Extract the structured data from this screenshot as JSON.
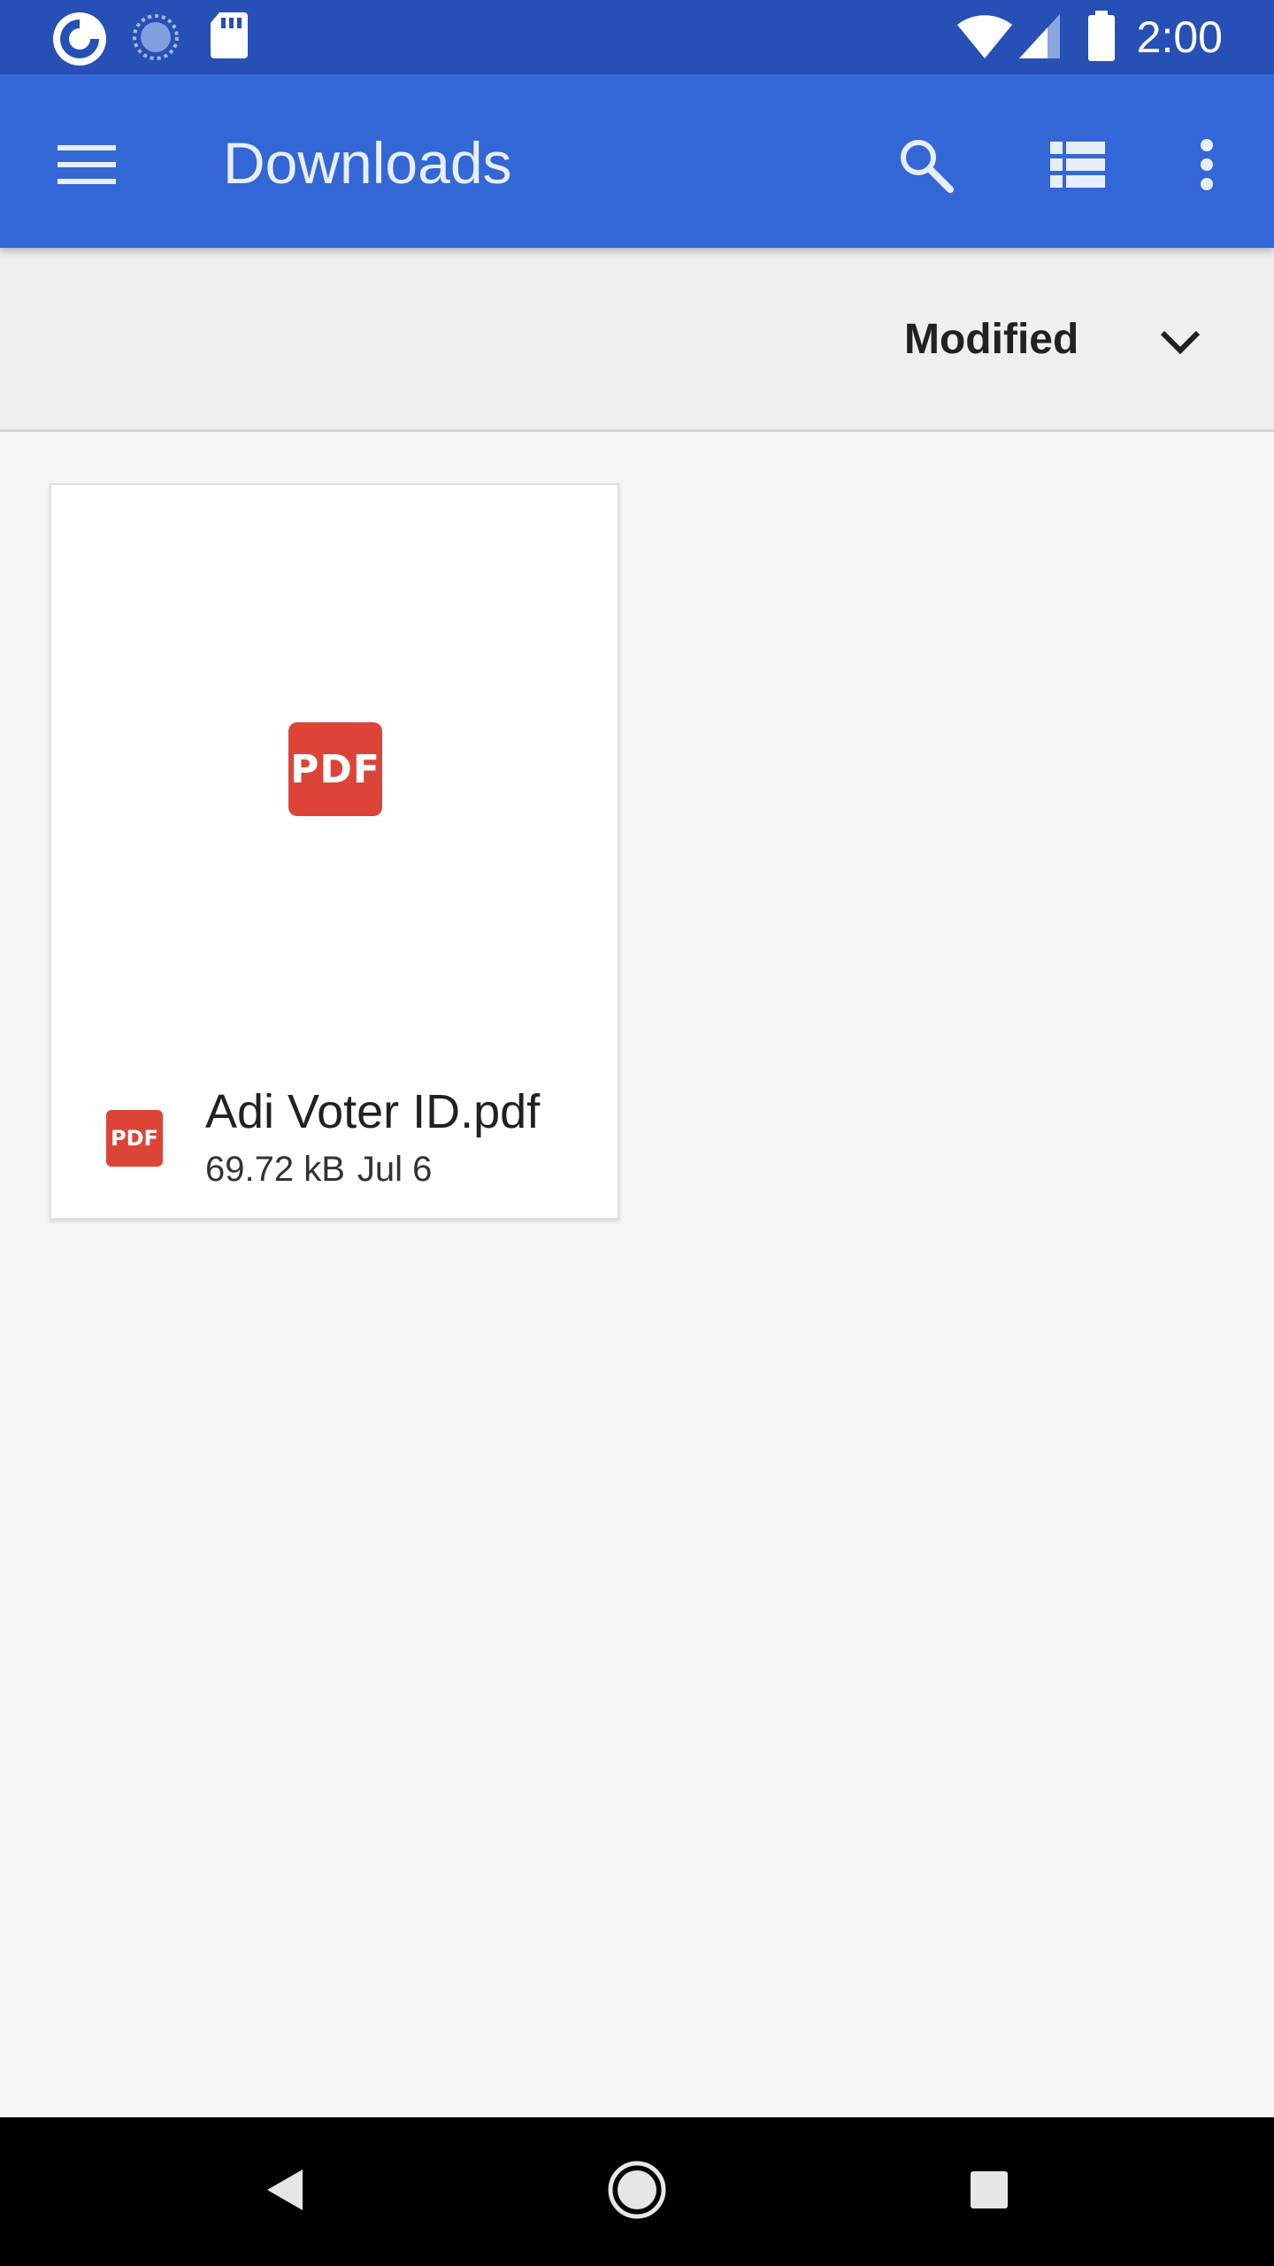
{
  "status_bar": {
    "time": "2:00",
    "left_icons": [
      "app-notification-icon",
      "sync-icon",
      "sd-card-icon"
    ],
    "right_icons": [
      "wifi-icon",
      "cell-signal-icon",
      "battery-icon"
    ]
  },
  "app_bar": {
    "title": "Downloads",
    "icons": [
      "menu-icon",
      "search-icon",
      "list-view-icon",
      "more-vert-icon"
    ]
  },
  "sort_bar": {
    "label": "Modified"
  },
  "files": [
    {
      "type_badge": "PDF",
      "name": "Adi Voter ID.pdf",
      "size": "69.72 kB",
      "date": "Jul 6"
    }
  ],
  "nav_bar": {
    "icons": [
      "back-icon",
      "home-icon",
      "recents-icon"
    ]
  },
  "colors": {
    "status_bar": "#2750b6",
    "app_bar": "#3367d6",
    "pdf_red": "#dc4437",
    "background": "#f5f5f5"
  }
}
